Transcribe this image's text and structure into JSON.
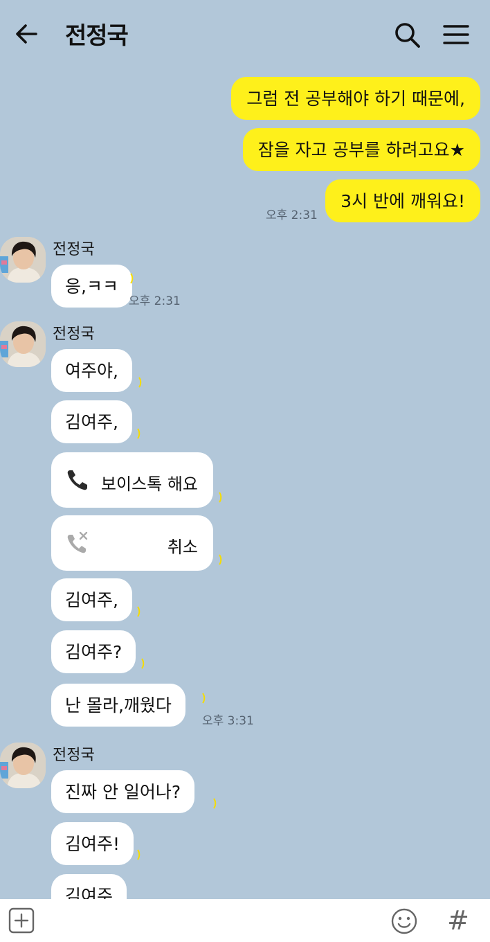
{
  "header": {
    "title": "전정국",
    "back_icon": "arrow-left-icon",
    "search_icon": "search-icon",
    "menu_icon": "hamburger-menu-icon"
  },
  "colors": {
    "background": "#b2c7d9",
    "my_bubble": "#fef01b",
    "other_bubble": "#ffffff",
    "read_mark": "#f5dc00"
  },
  "messages": {
    "me_1": "그럼 전 공부해야 하기 때문에,",
    "me_2": "잠을 자고 공부를  하려고요★",
    "me_3": "3시 반에 깨워요!",
    "me_time": "오후 2:31",
    "g1_sender": "전정국",
    "g1_m1": "응,ㅋㅋ",
    "g1_time": "오후 2:31",
    "g2_sender": "전정국",
    "g2_m1": "여주야,",
    "g2_m2": "김여주,",
    "g2_call1_label": "보이스톡 해요",
    "g2_call1_icon": "phone-icon",
    "g2_call2_label": "취소",
    "g2_call2_icon": "phone-cancelled-icon",
    "g2_m3": "김여주,",
    "g2_m4": "김여주?",
    "g2_m5": "난 몰라,깨웠다",
    "g2_time": "오후 3:31",
    "g3_sender": "전정국",
    "g3_m1": "진짜 안 일어나?",
    "g3_m2": "김여주!",
    "g3_m3": "김여주"
  },
  "footer": {
    "plus_icon": "plus-square-icon",
    "emoji_icon": "smiley-icon",
    "hash_label": "#"
  }
}
